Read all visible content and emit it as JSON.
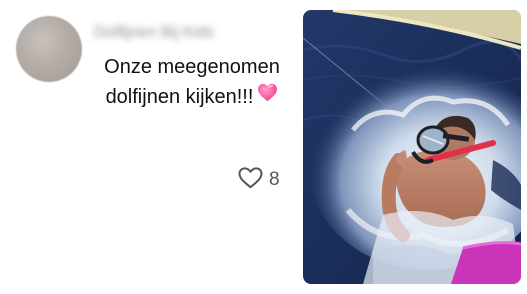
{
  "comment": {
    "author": "Dolfijnen Bij Kids",
    "lines": [
      "Onze meegenomen",
      "dolfijnen kijken!!!"
    ],
    "emoji": "pink-heart",
    "likes": {
      "icon": "heart-outline-icon",
      "count": "8"
    }
  },
  "photo": {
    "subject": "snorkeler-in-sea"
  },
  "colors": {
    "text": "#111111",
    "muted": "#55565c",
    "heart_emoji": "#ff5fa2",
    "sea_dark": "#1b2f5c",
    "snorkel_red": "#e0304a",
    "towel_pink": "#c934b8"
  }
}
